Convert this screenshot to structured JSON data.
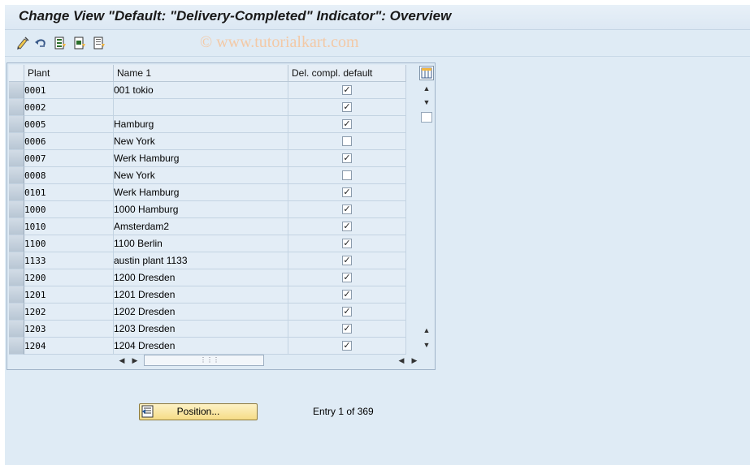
{
  "title": "Change View \"Default: \"Delivery-Completed\" Indicator\": Overview",
  "watermark": "© www.tutorialkart.com",
  "toolbar": {
    "icons": [
      "change-display-icon",
      "undo-icon",
      "select-all-icon",
      "select-block-icon",
      "deselect-all-icon"
    ]
  },
  "table": {
    "headers": {
      "plant": "Plant",
      "name": "Name 1",
      "del": "Del. compl. default"
    },
    "rows": [
      {
        "plant": "0001",
        "name": "001 tokio",
        "checked": true
      },
      {
        "plant": "0002",
        "name": "",
        "checked": true
      },
      {
        "plant": "0005",
        "name": "Hamburg",
        "checked": true
      },
      {
        "plant": "0006",
        "name": "New York",
        "checked": false
      },
      {
        "plant": "0007",
        "name": "Werk Hamburg",
        "checked": true
      },
      {
        "plant": "0008",
        "name": "New York",
        "checked": false
      },
      {
        "plant": "0101",
        "name": "Werk Hamburg",
        "checked": true
      },
      {
        "plant": "1000",
        "name": "1000 Hamburg",
        "checked": true
      },
      {
        "plant": "1010",
        "name": "Amsterdam2",
        "checked": true
      },
      {
        "plant": "1100",
        "name": "1100 Berlin",
        "checked": true
      },
      {
        "plant": "1133",
        "name": "austin plant 1133",
        "checked": true
      },
      {
        "plant": "1200",
        "name": "1200 Dresden",
        "checked": true
      },
      {
        "plant": "1201",
        "name": "1201 Dresden",
        "checked": true
      },
      {
        "plant": "1202",
        "name": "1202 Dresden",
        "checked": true
      },
      {
        "plant": "1203",
        "name": "1203 Dresden",
        "checked": true
      },
      {
        "plant": "1204",
        "name": "1204 Dresden",
        "checked": true
      }
    ]
  },
  "footer": {
    "position_label": "Position...",
    "entry_text": "Entry 1 of 369"
  },
  "colors": {
    "accent_button": "#f6dc86",
    "background": "#dfebf5"
  }
}
